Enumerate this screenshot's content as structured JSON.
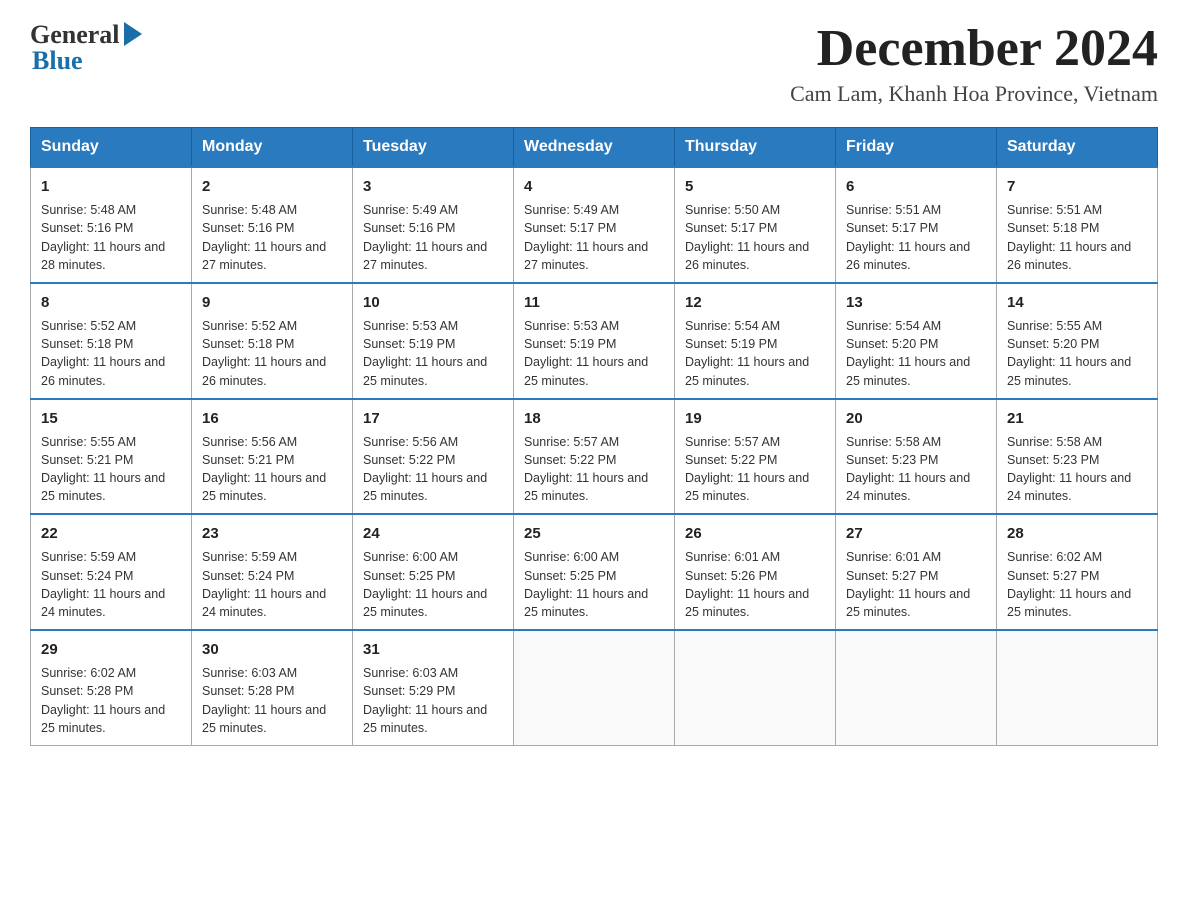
{
  "header": {
    "logo_general": "General",
    "logo_blue": "Blue",
    "month_title": "December 2024",
    "location": "Cam Lam, Khanh Hoa Province, Vietnam"
  },
  "days_of_week": [
    "Sunday",
    "Monday",
    "Tuesday",
    "Wednesday",
    "Thursday",
    "Friday",
    "Saturday"
  ],
  "weeks": [
    [
      {
        "day": "1",
        "sunrise": "5:48 AM",
        "sunset": "5:16 PM",
        "daylight": "11 hours and 28 minutes."
      },
      {
        "day": "2",
        "sunrise": "5:48 AM",
        "sunset": "5:16 PM",
        "daylight": "11 hours and 27 minutes."
      },
      {
        "day": "3",
        "sunrise": "5:49 AM",
        "sunset": "5:16 PM",
        "daylight": "11 hours and 27 minutes."
      },
      {
        "day": "4",
        "sunrise": "5:49 AM",
        "sunset": "5:17 PM",
        "daylight": "11 hours and 27 minutes."
      },
      {
        "day": "5",
        "sunrise": "5:50 AM",
        "sunset": "5:17 PM",
        "daylight": "11 hours and 26 minutes."
      },
      {
        "day": "6",
        "sunrise": "5:51 AM",
        "sunset": "5:17 PM",
        "daylight": "11 hours and 26 minutes."
      },
      {
        "day": "7",
        "sunrise": "5:51 AM",
        "sunset": "5:18 PM",
        "daylight": "11 hours and 26 minutes."
      }
    ],
    [
      {
        "day": "8",
        "sunrise": "5:52 AM",
        "sunset": "5:18 PM",
        "daylight": "11 hours and 26 minutes."
      },
      {
        "day": "9",
        "sunrise": "5:52 AM",
        "sunset": "5:18 PM",
        "daylight": "11 hours and 26 minutes."
      },
      {
        "day": "10",
        "sunrise": "5:53 AM",
        "sunset": "5:19 PM",
        "daylight": "11 hours and 25 minutes."
      },
      {
        "day": "11",
        "sunrise": "5:53 AM",
        "sunset": "5:19 PM",
        "daylight": "11 hours and 25 minutes."
      },
      {
        "day": "12",
        "sunrise": "5:54 AM",
        "sunset": "5:19 PM",
        "daylight": "11 hours and 25 minutes."
      },
      {
        "day": "13",
        "sunrise": "5:54 AM",
        "sunset": "5:20 PM",
        "daylight": "11 hours and 25 minutes."
      },
      {
        "day": "14",
        "sunrise": "5:55 AM",
        "sunset": "5:20 PM",
        "daylight": "11 hours and 25 minutes."
      }
    ],
    [
      {
        "day": "15",
        "sunrise": "5:55 AM",
        "sunset": "5:21 PM",
        "daylight": "11 hours and 25 minutes."
      },
      {
        "day": "16",
        "sunrise": "5:56 AM",
        "sunset": "5:21 PM",
        "daylight": "11 hours and 25 minutes."
      },
      {
        "day": "17",
        "sunrise": "5:56 AM",
        "sunset": "5:22 PM",
        "daylight": "11 hours and 25 minutes."
      },
      {
        "day": "18",
        "sunrise": "5:57 AM",
        "sunset": "5:22 PM",
        "daylight": "11 hours and 25 minutes."
      },
      {
        "day": "19",
        "sunrise": "5:57 AM",
        "sunset": "5:22 PM",
        "daylight": "11 hours and 25 minutes."
      },
      {
        "day": "20",
        "sunrise": "5:58 AM",
        "sunset": "5:23 PM",
        "daylight": "11 hours and 24 minutes."
      },
      {
        "day": "21",
        "sunrise": "5:58 AM",
        "sunset": "5:23 PM",
        "daylight": "11 hours and 24 minutes."
      }
    ],
    [
      {
        "day": "22",
        "sunrise": "5:59 AM",
        "sunset": "5:24 PM",
        "daylight": "11 hours and 24 minutes."
      },
      {
        "day": "23",
        "sunrise": "5:59 AM",
        "sunset": "5:24 PM",
        "daylight": "11 hours and 24 minutes."
      },
      {
        "day": "24",
        "sunrise": "6:00 AM",
        "sunset": "5:25 PM",
        "daylight": "11 hours and 25 minutes."
      },
      {
        "day": "25",
        "sunrise": "6:00 AM",
        "sunset": "5:25 PM",
        "daylight": "11 hours and 25 minutes."
      },
      {
        "day": "26",
        "sunrise": "6:01 AM",
        "sunset": "5:26 PM",
        "daylight": "11 hours and 25 minutes."
      },
      {
        "day": "27",
        "sunrise": "6:01 AM",
        "sunset": "5:27 PM",
        "daylight": "11 hours and 25 minutes."
      },
      {
        "day": "28",
        "sunrise": "6:02 AM",
        "sunset": "5:27 PM",
        "daylight": "11 hours and 25 minutes."
      }
    ],
    [
      {
        "day": "29",
        "sunrise": "6:02 AM",
        "sunset": "5:28 PM",
        "daylight": "11 hours and 25 minutes."
      },
      {
        "day": "30",
        "sunrise": "6:03 AM",
        "sunset": "5:28 PM",
        "daylight": "11 hours and 25 minutes."
      },
      {
        "day": "31",
        "sunrise": "6:03 AM",
        "sunset": "5:29 PM",
        "daylight": "11 hours and 25 minutes."
      },
      null,
      null,
      null,
      null
    ]
  ]
}
